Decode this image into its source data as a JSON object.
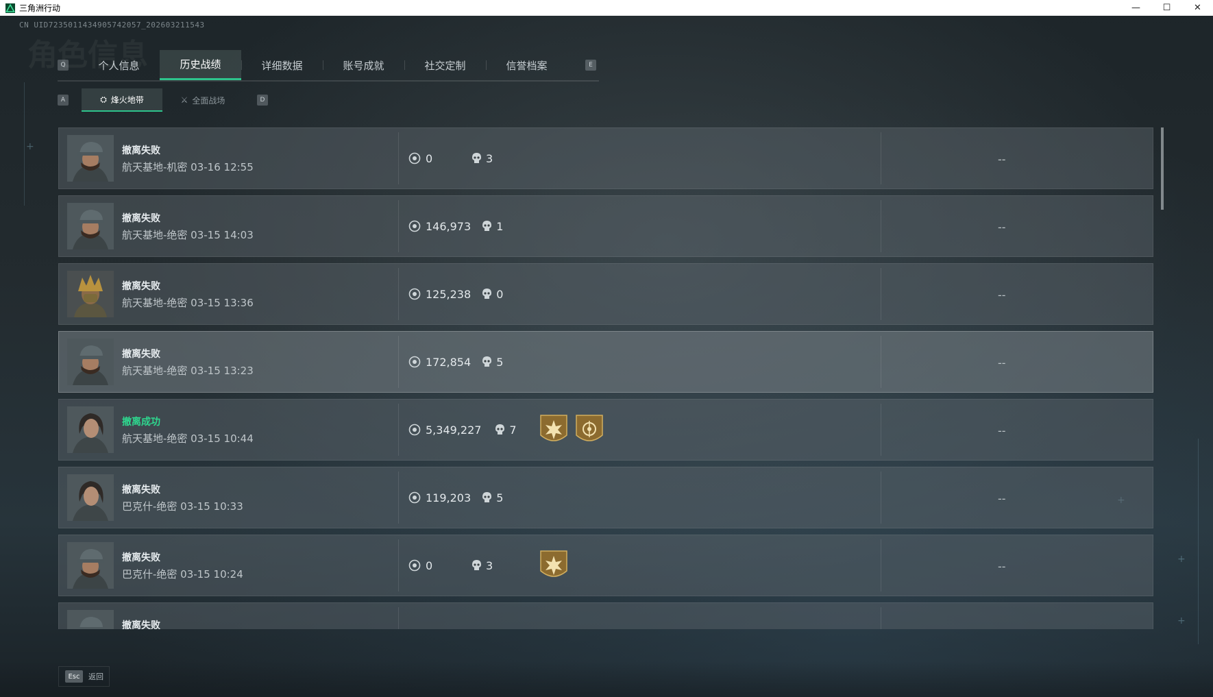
{
  "window": {
    "title": "三角洲行动",
    "minimize": "—",
    "maximize": "☐",
    "close": "✕"
  },
  "uid": "CN UID7235011434905742057_202603211543",
  "ghost_title": "角色信息",
  "tabs": {
    "key_left": "Q",
    "key_right": "E",
    "items": [
      {
        "label": "个人信息",
        "active": false
      },
      {
        "label": "历史战绩",
        "active": true
      },
      {
        "label": "详细数据",
        "active": false
      },
      {
        "label": "账号成就",
        "active": false
      },
      {
        "label": "社交定制",
        "active": false
      },
      {
        "label": "信誉档案",
        "active": false
      }
    ]
  },
  "subtabs": {
    "key_left": "A",
    "key_right": "D",
    "items": [
      {
        "label": "烽火地带",
        "icon": "hazard-icon",
        "active": true
      },
      {
        "label": "全面战场",
        "icon": "battlefield-icon",
        "active": false
      }
    ]
  },
  "records": [
    {
      "status": "撤离失败",
      "success": false,
      "map": "航天基地-机密 03-16 12:55",
      "value": "0",
      "kills": "3",
      "badges": [],
      "extra": "--",
      "avatar": "soldier-cap",
      "highlight": false
    },
    {
      "status": "撤离失败",
      "success": false,
      "map": "航天基地-绝密 03-15 14:03",
      "value": "146,973",
      "kills": "1",
      "badges": [],
      "extra": "--",
      "avatar": "soldier-cap",
      "highlight": false
    },
    {
      "status": "撤离失败",
      "success": false,
      "map": "航天基地-绝密 03-15 13:36",
      "value": "125,238",
      "kills": "0",
      "badges": [],
      "extra": "--",
      "avatar": "soldier-gold",
      "highlight": false
    },
    {
      "status": "撤离失败",
      "success": false,
      "map": "航天基地-绝密 03-15 13:23",
      "value": "172,854",
      "kills": "5",
      "badges": [],
      "extra": "--",
      "avatar": "soldier-cap",
      "highlight": true
    },
    {
      "status": "撤离成功",
      "success": true,
      "map": "航天基地-绝密 03-15 10:44",
      "value": "5,349,227",
      "kills": "7",
      "badges": [
        "sun-badge",
        "target-badge"
      ],
      "extra": "--",
      "avatar": "soldier-female",
      "highlight": false
    },
    {
      "status": "撤离失败",
      "success": false,
      "map": "巴克什-绝密 03-15 10:33",
      "value": "119,203",
      "kills": "5",
      "badges": [],
      "extra": "--",
      "avatar": "soldier-female",
      "highlight": false
    },
    {
      "status": "撤离失败",
      "success": false,
      "map": "巴克什-绝密 03-15 10:24",
      "value": "0",
      "kills": "3",
      "badges": [
        "sun-badge"
      ],
      "extra": "--",
      "avatar": "soldier-cap",
      "highlight": false
    },
    {
      "status": "撤离失败",
      "success": false,
      "map": "",
      "value": "",
      "kills": "",
      "badges": [],
      "extra": "",
      "avatar": "soldier-cap",
      "highlight": false
    }
  ],
  "footer": {
    "key": "Esc",
    "label": "返回"
  },
  "colors": {
    "accent": "#2ec48c",
    "success": "#2ed88f",
    "badge_gold": "#b08a3e"
  }
}
